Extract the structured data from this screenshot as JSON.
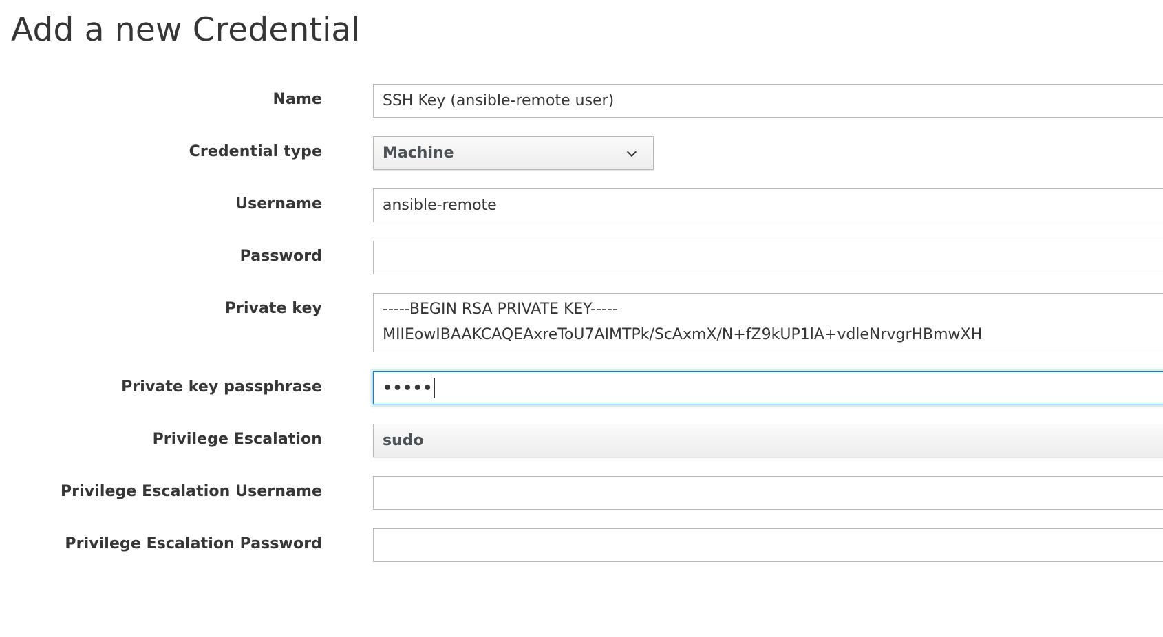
{
  "page": {
    "title": "Add a new Credential"
  },
  "form": {
    "name": {
      "label": "Name",
      "value": "SSH Key (ansible-remote user)"
    },
    "credential_type": {
      "label": "Credential type",
      "selected": "Machine",
      "icon": "chevron-down-icon"
    },
    "username": {
      "label": "Username",
      "value": "ansible-remote"
    },
    "password": {
      "label": "Password",
      "value": ""
    },
    "private_key": {
      "label": "Private key",
      "lines": [
        "-----BEGIN RSA PRIVATE KEY-----",
        "MIIEowIBAAKCAQEAxreToU7AIMTPk/ScAxmX/N+fZ9kUP1lA+vdleNrvgrHBmwXH"
      ]
    },
    "private_key_passphrase": {
      "label": "Private key passphrase",
      "masked_value": "•••••"
    },
    "privilege_escalation": {
      "label": "Privilege Escalation",
      "selected": "sudo"
    },
    "privilege_escalation_username": {
      "label": "Privilege Escalation Username",
      "value": ""
    },
    "privilege_escalation_password": {
      "label": "Privilege Escalation Password",
      "value": ""
    }
  },
  "colors": {
    "focus_border": "#0088ce",
    "text": "#363636",
    "field_border": "#bbbbbb"
  }
}
